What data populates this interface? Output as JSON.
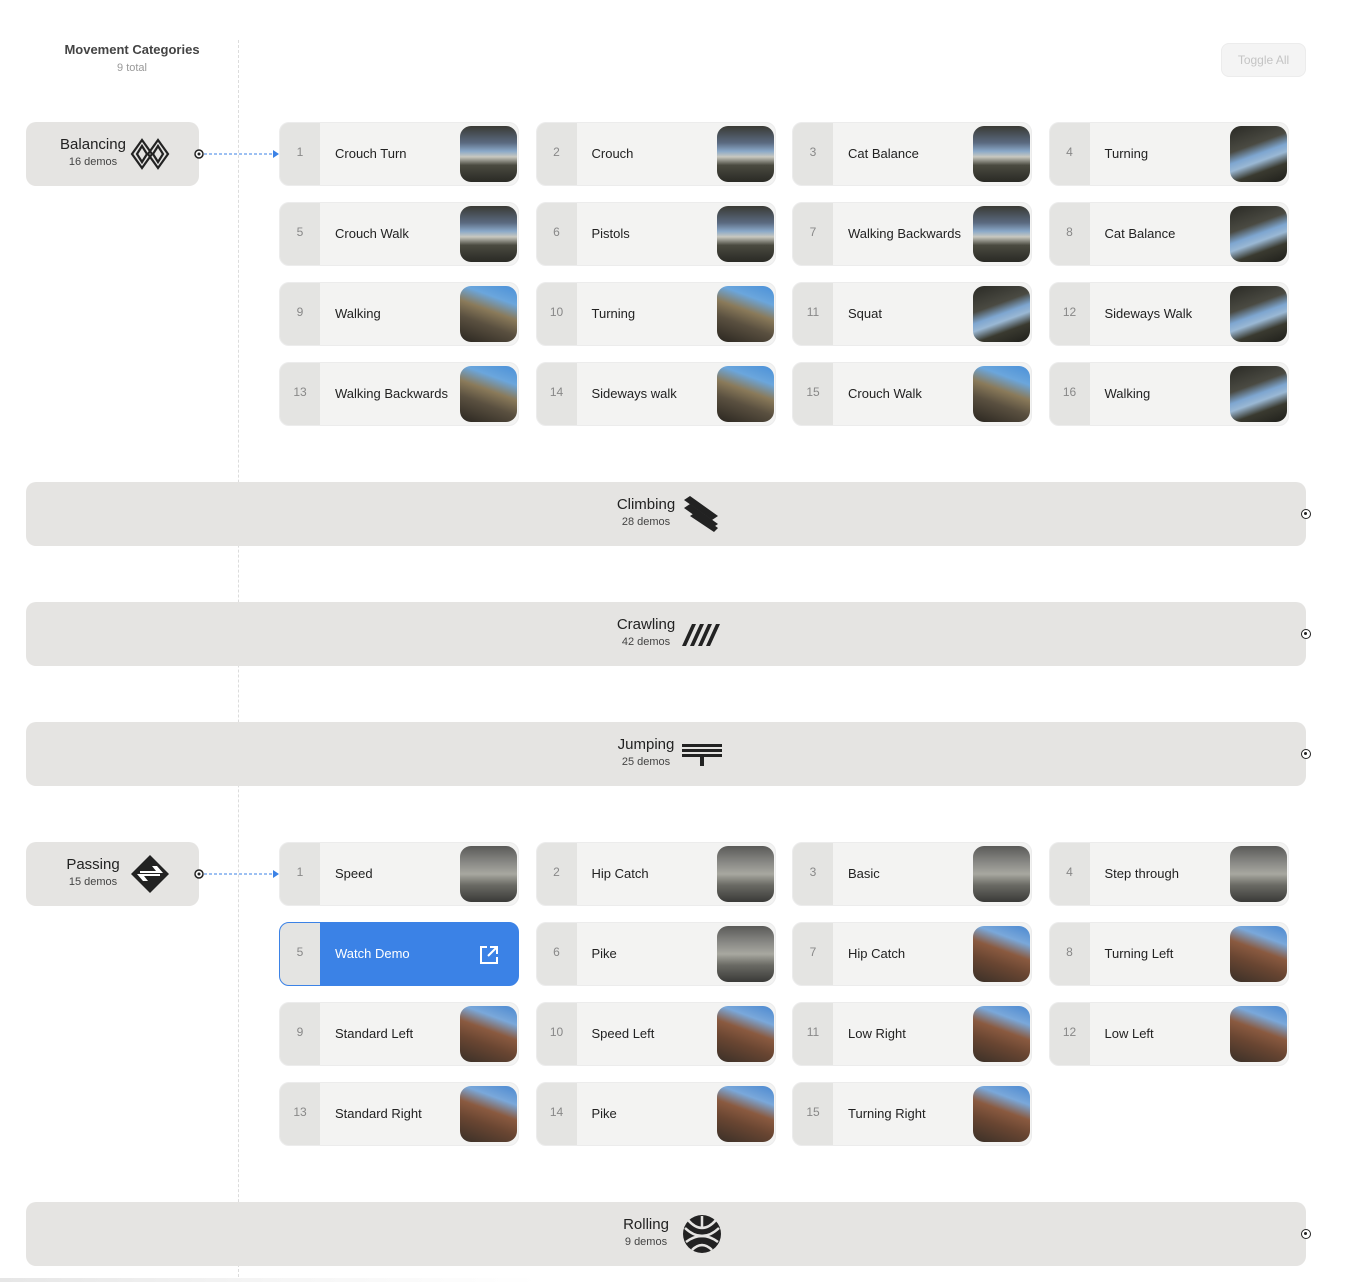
{
  "header": {
    "title": "Movement Categories",
    "subtitle": "9 total"
  },
  "toolbar": {
    "toggle_all": "Toggle All"
  },
  "categories": {
    "balancing": {
      "name": "Balancing",
      "count": "16 demos",
      "icon": "balancing-icon",
      "demos": [
        {
          "num": "1",
          "label": "Crouch Turn"
        },
        {
          "num": "2",
          "label": "Crouch"
        },
        {
          "num": "3",
          "label": "Cat Balance"
        },
        {
          "num": "4",
          "label": "Turning"
        },
        {
          "num": "5",
          "label": "Crouch Walk"
        },
        {
          "num": "6",
          "label": "Pistols"
        },
        {
          "num": "7",
          "label": "Walking Backwards"
        },
        {
          "num": "8",
          "label": "Cat Balance"
        },
        {
          "num": "9",
          "label": "Walking"
        },
        {
          "num": "10",
          "label": "Turning"
        },
        {
          "num": "11",
          "label": "Squat"
        },
        {
          "num": "12",
          "label": "Sideways Walk"
        },
        {
          "num": "13",
          "label": "Walking Backwards"
        },
        {
          "num": "14",
          "label": "Sideways walk"
        },
        {
          "num": "15",
          "label": "Crouch Walk"
        },
        {
          "num": "16",
          "label": "Walking"
        }
      ]
    },
    "climbing": {
      "name": "Climbing",
      "count": "28 demos",
      "icon": "climbing-icon"
    },
    "crawling": {
      "name": "Crawling",
      "count": "42 demos",
      "icon": "crawling-icon"
    },
    "jumping": {
      "name": "Jumping",
      "count": "25 demos",
      "icon": "jumping-icon"
    },
    "passing": {
      "name": "Passing",
      "count": "15 demos",
      "icon": "passing-icon",
      "demos": [
        {
          "num": "1",
          "label": "Speed"
        },
        {
          "num": "2",
          "label": "Hip Catch"
        },
        {
          "num": "3",
          "label": "Basic"
        },
        {
          "num": "4",
          "label": "Step through"
        },
        {
          "num": "5",
          "label": "Watch Demo"
        },
        {
          "num": "6",
          "label": "Pike"
        },
        {
          "num": "7",
          "label": "Hip Catch"
        },
        {
          "num": "8",
          "label": "Turning Left"
        },
        {
          "num": "9",
          "label": "Standard Left"
        },
        {
          "num": "10",
          "label": "Speed Left"
        },
        {
          "num": "11",
          "label": "Low Right"
        },
        {
          "num": "12",
          "label": "Low Left"
        },
        {
          "num": "13",
          "label": "Standard Right"
        },
        {
          "num": "14",
          "label": "Pike"
        },
        {
          "num": "15",
          "label": "Turning Right"
        }
      ]
    },
    "rolling": {
      "name": "Rolling",
      "count": "9 demos",
      "icon": "rolling-icon"
    }
  },
  "colors": {
    "accent": "#3b82e6",
    "card_bg": "#f3f3f2",
    "category_bg": "#e5e4e2",
    "connector": "#3b82e6"
  }
}
